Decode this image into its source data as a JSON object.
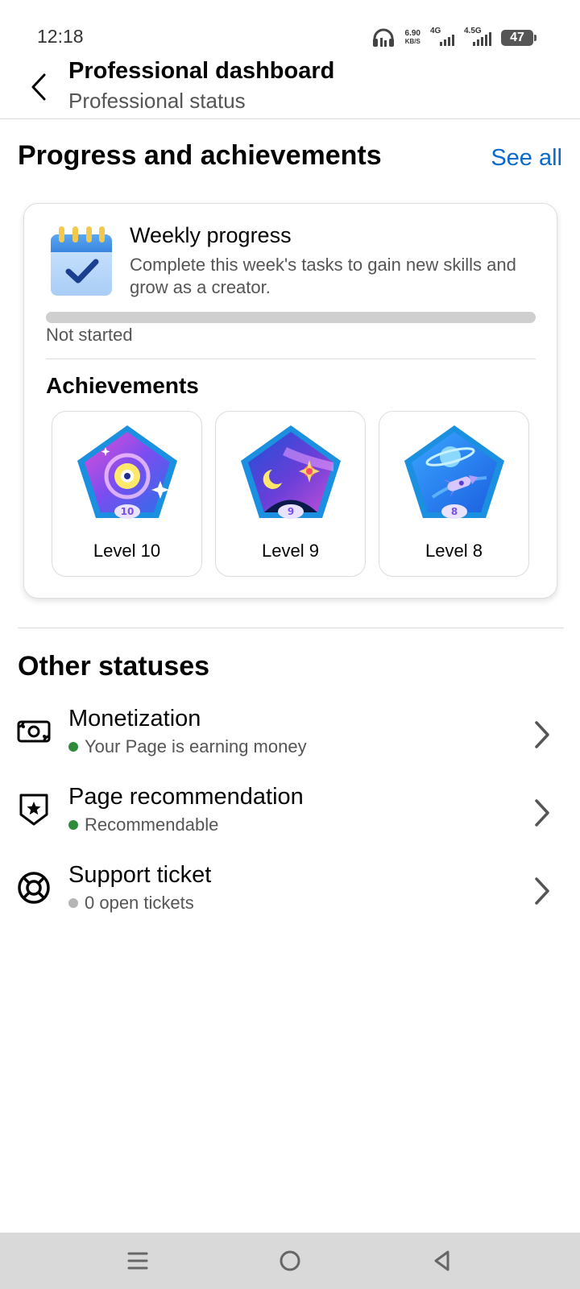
{
  "status_bar": {
    "time": "12:18",
    "speed_value": "6.90",
    "speed_unit": "KB/S",
    "net1": "4G",
    "net2": "4.5G",
    "battery": "47"
  },
  "header": {
    "title": "Professional dashboard",
    "subtitle": "Professional status"
  },
  "progress_section": {
    "title": "Progress and achievements",
    "see_all": "See all",
    "weekly": {
      "title": "Weekly progress",
      "description": "Complete this week's tasks to gain new skills and grow as a creator.",
      "progress": 0,
      "status": "Not started"
    },
    "achievements_title": "Achievements",
    "badges": [
      {
        "number": "10",
        "label": "Level 10",
        "theme": "galaxy-icon"
      },
      {
        "number": "9",
        "label": "Level 9",
        "theme": "night-sky-icon"
      },
      {
        "number": "8",
        "label": "Level 8",
        "theme": "rocket-icon"
      }
    ]
  },
  "other_statuses": {
    "title": "Other statuses",
    "items": [
      {
        "title": "Monetization",
        "subtitle": "Your Page is earning money",
        "dot_color": "#2e8b3a",
        "icon": "money-icon"
      },
      {
        "title": "Page recommendation",
        "subtitle": "Recommendable",
        "dot_color": "#2e8b3a",
        "icon": "shield-star-icon"
      },
      {
        "title": "Support ticket",
        "subtitle": "0 open tickets",
        "dot_color": "#b5b5b5",
        "icon": "lifebuoy-icon"
      }
    ]
  },
  "colors": {
    "accent": "#0a6ac9",
    "status_ok": "#2e8b3a",
    "status_neutral": "#b5b5b5"
  }
}
